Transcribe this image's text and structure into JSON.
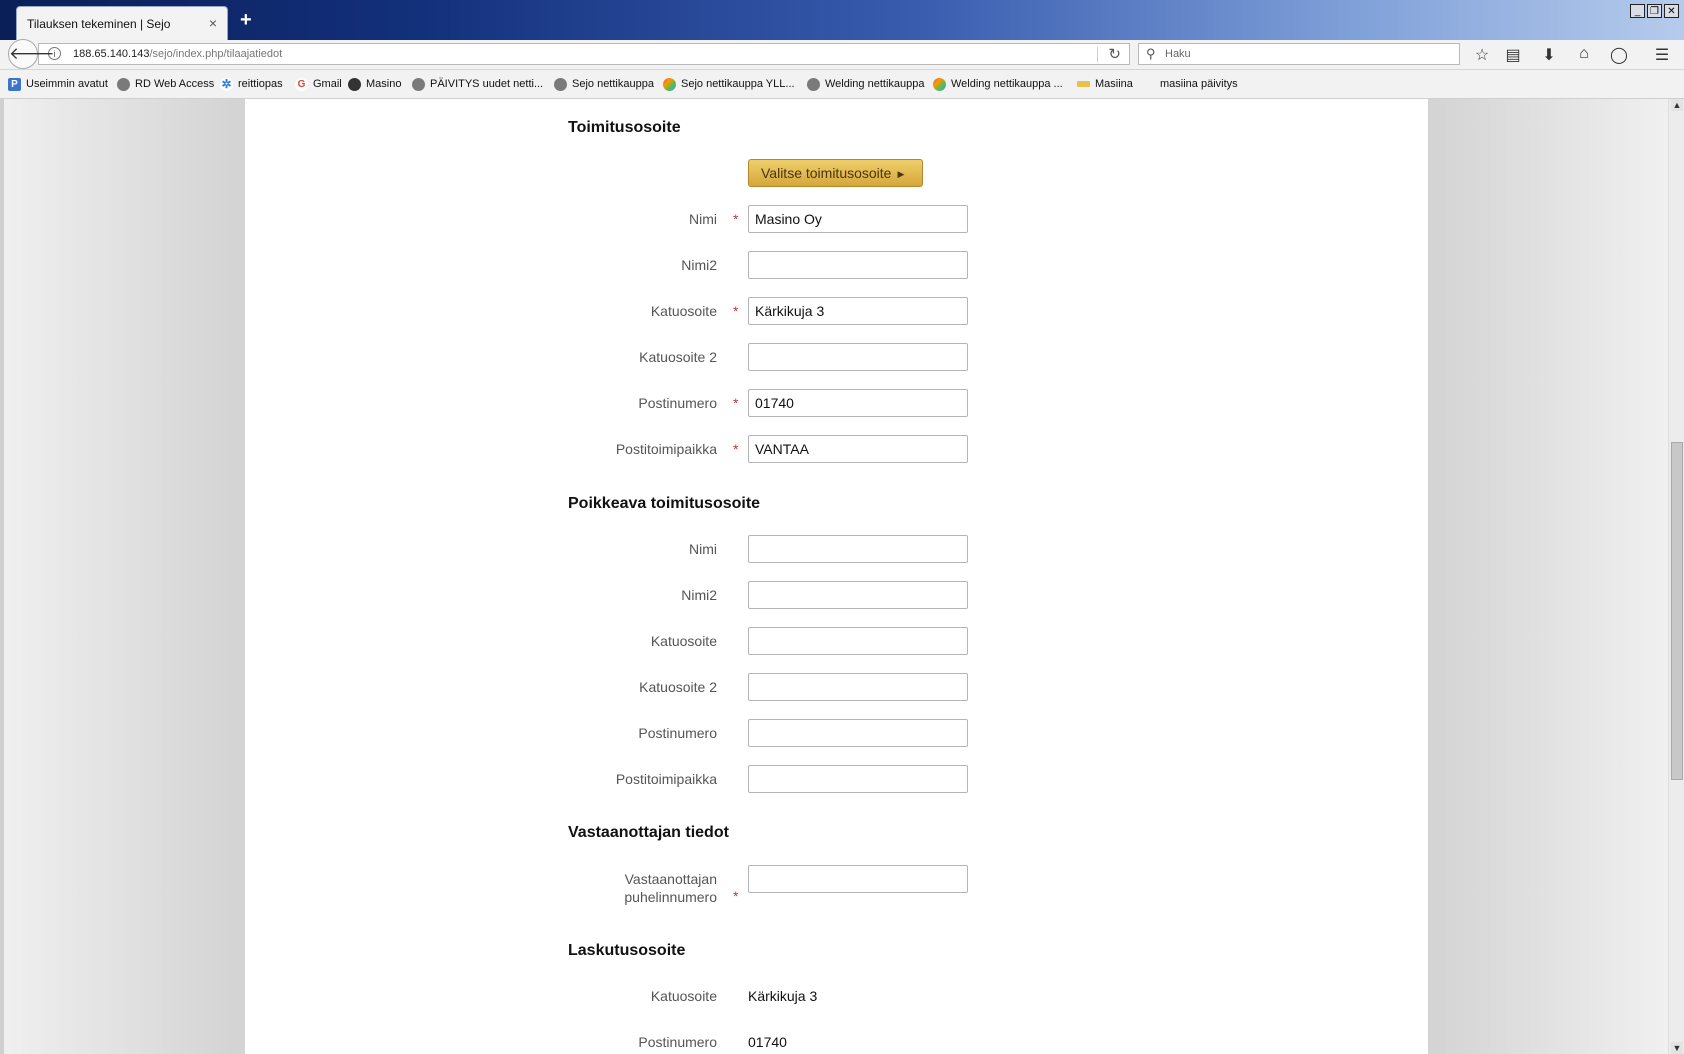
{
  "browser": {
    "tab_title": "Tilauksen tekeminen | Sejo",
    "tab_close": "×",
    "new_tab": "+",
    "window_controls": [
      "_",
      "❐",
      "✕"
    ],
    "url_host": "188.65.140.143",
    "url_path": "/sejo/index.php/tilaajatiedot",
    "search_placeholder": "Haku",
    "bookmarks": [
      {
        "label": "Useimmin avatut",
        "icon": "frequent-icon"
      },
      {
        "label": "RD Web Access",
        "icon": "globe-icon"
      },
      {
        "label": "reittiopas",
        "icon": "gear-icon"
      },
      {
        "label": "Gmail",
        "icon": "google-icon"
      },
      {
        "label": "Masino",
        "icon": "masino-icon"
      },
      {
        "label": "PÄIVITYS uudet netti...",
        "icon": "globe-icon"
      },
      {
        "label": "Sejo nettikauppa",
        "icon": "globe-icon"
      },
      {
        "label": "Sejo nettikauppa YLL...",
        "icon": "joomla-icon"
      },
      {
        "label": "Welding nettikauppa",
        "icon": "globe-icon"
      },
      {
        "label": "Welding nettikauppa ...",
        "icon": "joomla-icon"
      },
      {
        "label": "Masiina",
        "icon": "masiina-icon"
      },
      {
        "label": "masiina päivitys",
        "icon": "none"
      }
    ]
  },
  "form": {
    "delivery": {
      "title": "Toimitusosoite",
      "select_button": "Valitse toimitusosoite",
      "fields": [
        {
          "label": "Nimi",
          "required": true,
          "value": "Masino Oy"
        },
        {
          "label": "Nimi2",
          "required": false,
          "value": ""
        },
        {
          "label": "Katuosoite",
          "required": true,
          "value": "Kärkikuja 3"
        },
        {
          "label": "Katuosoite 2",
          "required": false,
          "value": ""
        },
        {
          "label": "Postinumero",
          "required": true,
          "value": "01740"
        },
        {
          "label": "Postitoimipaikka",
          "required": true,
          "value": "VANTAA"
        }
      ]
    },
    "alternate_delivery": {
      "title": "Poikkeava toimitusosoite",
      "fields": [
        {
          "label": "Nimi",
          "value": ""
        },
        {
          "label": "Nimi2",
          "value": ""
        },
        {
          "label": "Katuosoite",
          "value": ""
        },
        {
          "label": "Katuosoite 2",
          "value": ""
        },
        {
          "label": "Postinumero",
          "value": ""
        },
        {
          "label": "Postitoimipaikka",
          "value": ""
        }
      ]
    },
    "recipient": {
      "title": "Vastaanottajan tiedot",
      "phone_label_line1": "Vastaanottajan",
      "phone_label_line2": "puhelinnumero",
      "phone_value": ""
    },
    "billing": {
      "title": "Laskutusosoite",
      "street_label": "Katuosoite",
      "street_value": "Kärkikuja 3",
      "postcode_label": "Postinumero",
      "postcode_value": "01740"
    },
    "required_marker": "*"
  },
  "colors": {
    "button_gold": "#e6bc52",
    "required_red": "#c0392b"
  }
}
